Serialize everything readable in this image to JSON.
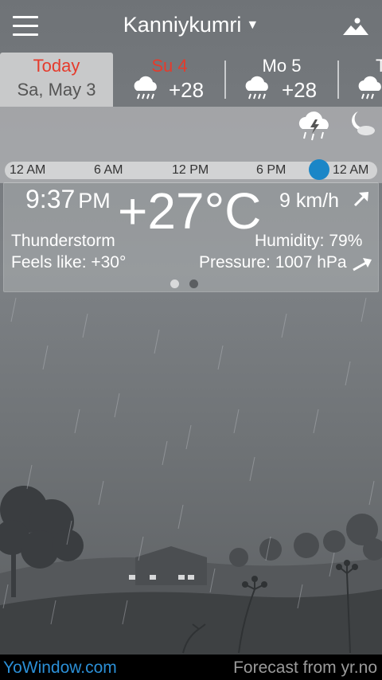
{
  "header": {
    "city": "Kanniykumri",
    "dropdown_glyph": "▼"
  },
  "days": [
    {
      "name": "Today",
      "date": "Sa, May 3",
      "selected": true
    },
    {
      "name": "Su 4",
      "temp": "+28",
      "icon": "rain-cloud-icon"
    },
    {
      "name": "Mo 5",
      "temp": "+28",
      "icon": "rain-cloud-icon"
    }
  ],
  "timeline": {
    "labels": [
      "12 AM",
      "6 AM",
      "12 PM",
      "6 PM",
      "12 AM"
    ],
    "current_position": 0.88
  },
  "current": {
    "time": "9:37",
    "ampm": "PM",
    "temperature": "+27°C",
    "wind": "9 km/h",
    "condition": "Thunderstorm",
    "feels_like": "Feels like: +30°",
    "humidity": "Humidity: 79%",
    "pressure": "Pressure: 1007 hPa",
    "page": 1,
    "pages": 2
  },
  "footer": {
    "brand": "YoWindow.com",
    "source": "Forecast from yr.no"
  },
  "colors": {
    "accent_blue": "#1a86c7",
    "today_red": "#e53b2c",
    "brand_blue": "#2b8fd6"
  }
}
